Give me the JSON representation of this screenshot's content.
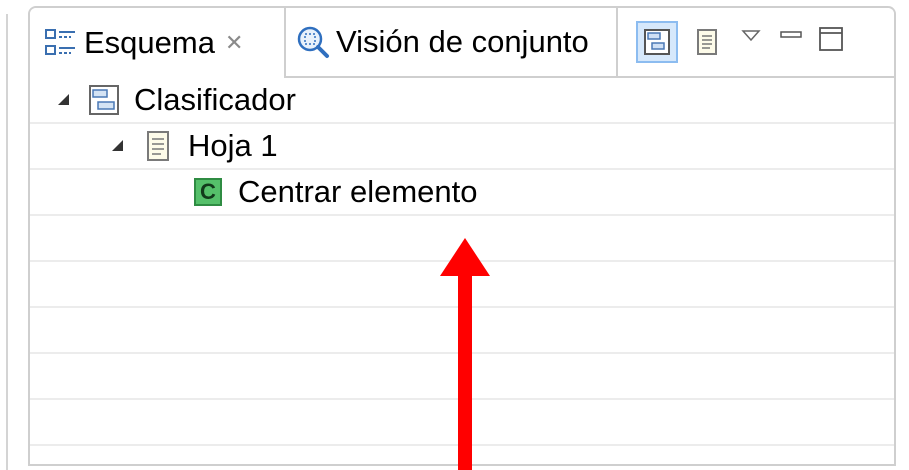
{
  "tabs": [
    {
      "label": "Esquema",
      "icon": "outline-icon",
      "active": true,
      "closable": true
    },
    {
      "label": "Visión de conjunto",
      "icon": "overview-magnifier-icon",
      "active": false
    }
  ],
  "toolbar": {
    "items": [
      {
        "icon": "tree-view-icon",
        "active": true
      },
      {
        "icon": "sheet-view-icon",
        "active": false
      },
      {
        "icon": "view-menu-icon"
      },
      {
        "icon": "minimize-icon"
      },
      {
        "icon": "maximize-icon"
      }
    ]
  },
  "tree": {
    "nodes": [
      {
        "label": "Clasificador",
        "icon": "classifier-icon",
        "expanded": true,
        "level": 0
      },
      {
        "label": "Hoja 1",
        "icon": "sheet-icon",
        "expanded": true,
        "level": 1
      },
      {
        "label": "Centrar elemento",
        "icon": "class-c-icon",
        "badge": "C",
        "level": 2
      }
    ],
    "empty_rows": 5
  },
  "annotation": {
    "type": "arrow",
    "color": "#ff0000",
    "direction": "up"
  }
}
